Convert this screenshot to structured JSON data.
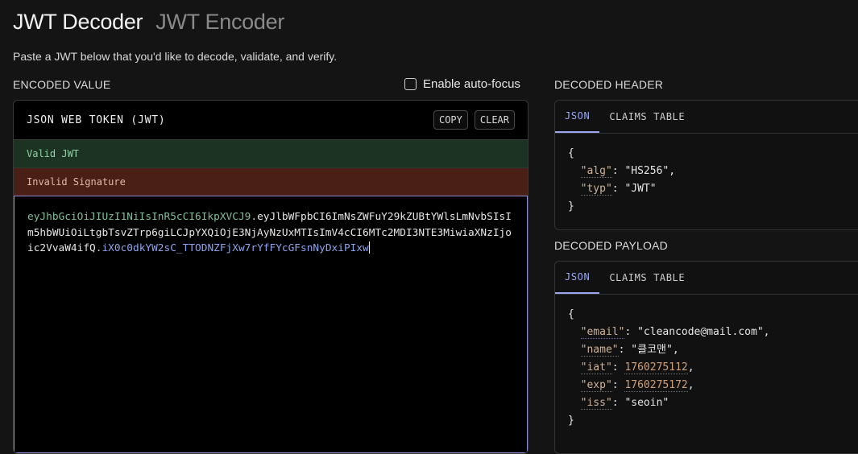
{
  "header": {
    "tab_decoder": "JWT Decoder",
    "tab_encoder": "JWT Encoder",
    "subtitle": "Paste a JWT below that you'd like to decode, validate, and verify."
  },
  "encoded": {
    "section_label": "ENCODED VALUE",
    "autofocus_label": "Enable auto-focus",
    "card_title": "JSON WEB TOKEN (JWT)",
    "copy_label": "COPY",
    "clear_label": "CLEAR",
    "status_valid": "Valid JWT",
    "status_invalid": "Invalid Signature",
    "token_header": "eyJhbGciOiJIUzI1NiIsInR5cCI6IkpXVCJ9",
    "token_payload": "eyJlbWFpbCI6ImNsZWFuY29kZUBtYWlsLmNvbSIsIm5hbWUiOiLtgbTsvZTrp6giLCJpYXQiOjE3NjAyNzUxMTIsImV4cCI6MTc2MDI3NTE3MiwiaXNzIjoic2VvaW4ifQ",
    "token_signature": "iX0c0dkYW2sC_TTODNZFjXw7rYfFYcGFsnNyDxiPIxw",
    "dot": "."
  },
  "decoded_header": {
    "section_label": "DECODED HEADER",
    "tab_json": "JSON",
    "tab_claims": "CLAIMS TABLE",
    "open_brace": "{",
    "close_brace": "}",
    "fields": [
      {
        "key": "\"alg\"",
        "value": "\"HS256\""
      },
      {
        "key": "\"typ\"",
        "value": "\"JWT\""
      }
    ]
  },
  "decoded_payload": {
    "section_label": "DECODED PAYLOAD",
    "tab_json": "JSON",
    "tab_claims": "CLAIMS TABLE",
    "open_brace": "{",
    "close_brace": "}",
    "fields": [
      {
        "key": "\"email\"",
        "value": "\"cleancode@mail.com\""
      },
      {
        "key": "\"name\"",
        "value": "\"클코맨\""
      },
      {
        "key": "\"iat\"",
        "value": "1760275112"
      },
      {
        "key": "\"exp\"",
        "value": "1760275172"
      },
      {
        "key": "\"iss\"",
        "value": "\"seoin\""
      }
    ]
  },
  "colors": {
    "valid_bg": "#1c3324",
    "invalid_bg": "#4a2016",
    "accent": "#9aa7f0"
  }
}
